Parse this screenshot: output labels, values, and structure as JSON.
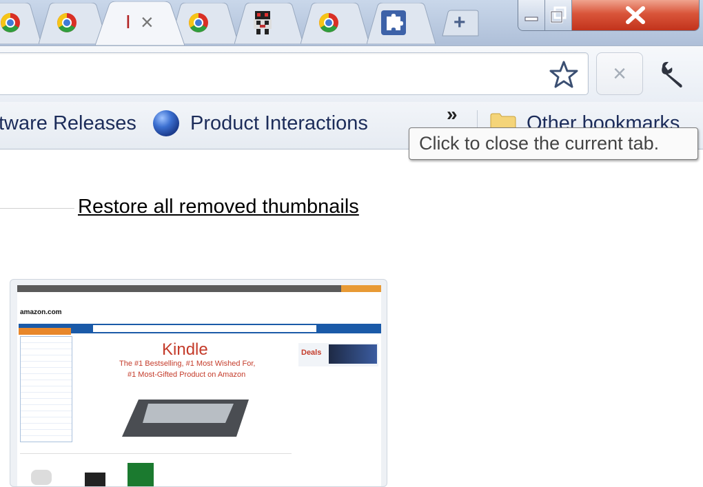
{
  "browser": {
    "active_tab": {
      "title": "I",
      "close_glyph": "×"
    },
    "tab_icons": [
      "chrome-logo-icon",
      "chrome-logo-icon",
      "chrome-logo-icon",
      "pixel-character-icon",
      "chrome-logo-icon",
      "puzzle-extension-icon"
    ],
    "new_tab_glyph": "+",
    "window_controls": {
      "minimize": "minimize-icon",
      "maximize": "restore-icon",
      "close": "close-icon"
    },
    "colors": {
      "close_button": "#d9553a",
      "tab_strip": "#c9d7ea",
      "active_tab": "#f4f6fa"
    }
  },
  "toolbar": {
    "star_icon": "bookmark-star-icon",
    "stop_glyph": "×",
    "wrench_icon": "wrench-icon"
  },
  "bookmarks": {
    "items": [
      {
        "label": "tware Releases"
      },
      {
        "label": "Product Interactions",
        "icon": "globe-icon"
      }
    ],
    "overflow_chevron": "»",
    "other_bookmarks": {
      "label": "Other bookmarks",
      "icon": "folder-icon"
    }
  },
  "tooltip": {
    "text": "Click to close the current tab."
  },
  "content": {
    "restore_link": "Restore all removed thumbnails",
    "thumbnail": {
      "site_logo": "amazon.com",
      "headline": "Kindle",
      "tagline_1": "The #1 Bestselling, #1 Most Wished For,",
      "tagline_2": "#1 Most-Gifted Product on Amazon",
      "deals_label": "Deals"
    }
  }
}
